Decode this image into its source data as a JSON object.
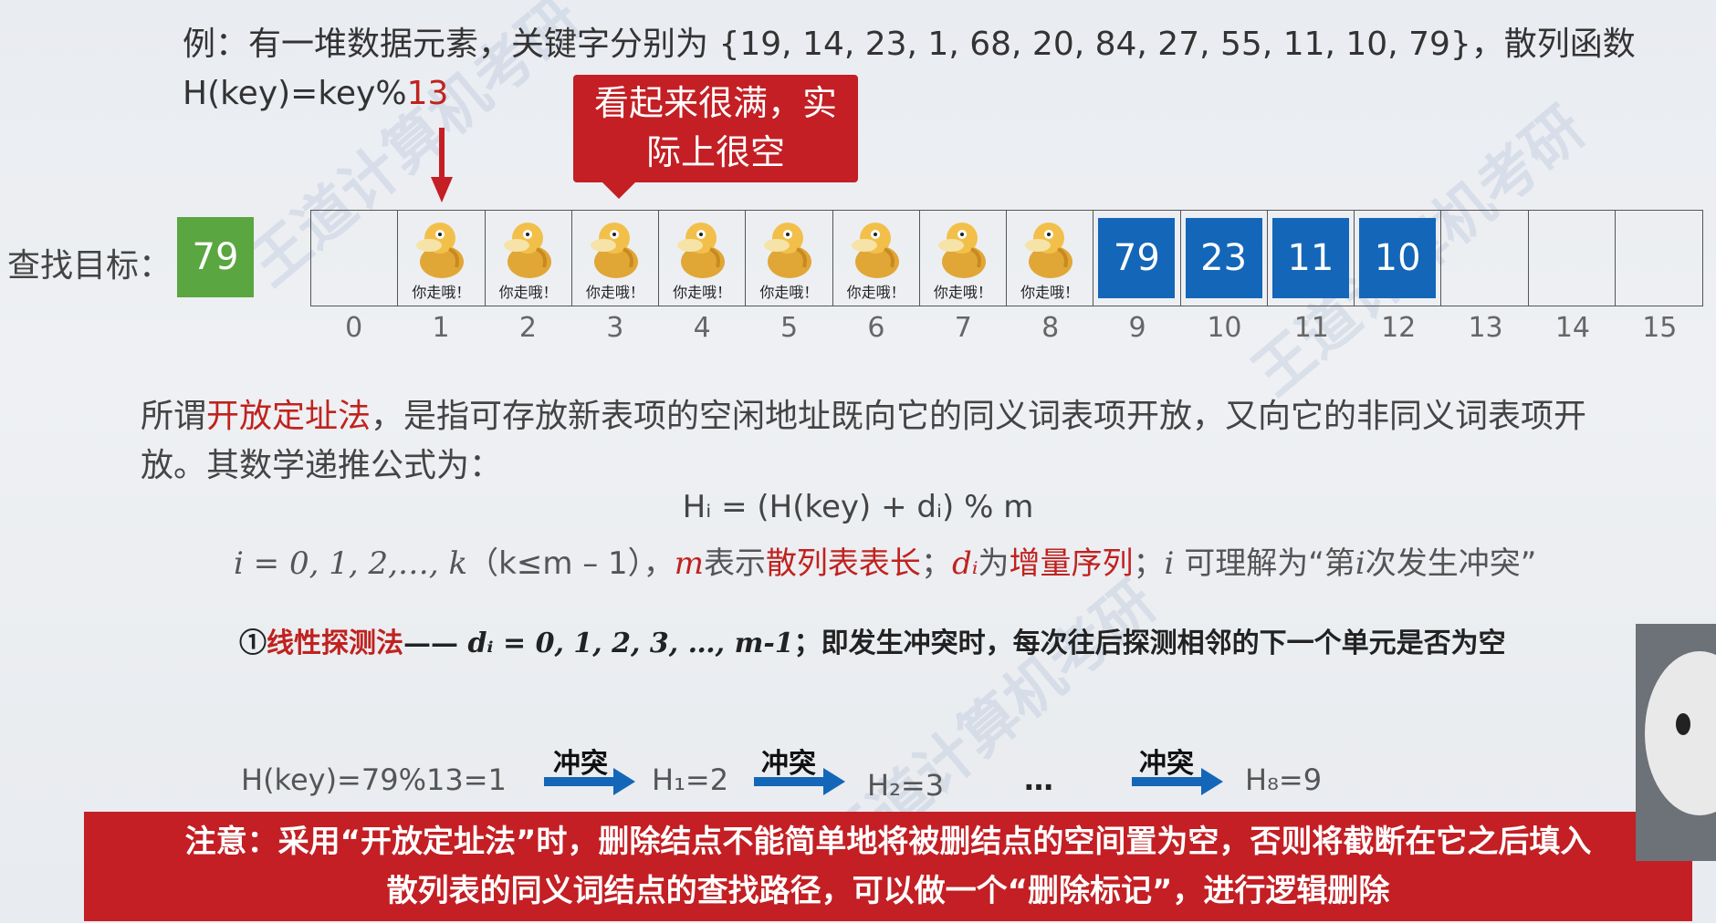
{
  "intro": {
    "line1": "例：有一堆数据元素，关键字分别为 {19, 14, 23, 1, 68, 20, 84, 27, 55, 11, 10, 79}，散列函数",
    "line2_prefix": "H(key)=key%",
    "line2_mod": "13"
  },
  "callout": {
    "line1": "看起来很满，实",
    "line2": "际上很空"
  },
  "target": {
    "label": "查找目标：",
    "value": "79"
  },
  "table": {
    "cells": [
      {
        "type": "empty",
        "text": ""
      },
      {
        "type": "duck",
        "text": "你走哦！"
      },
      {
        "type": "duck",
        "text": "你走哦！"
      },
      {
        "type": "duck",
        "text": "你走哦！"
      },
      {
        "type": "duck",
        "text": "你走哦！"
      },
      {
        "type": "duck",
        "text": "你走哦！"
      },
      {
        "type": "duck",
        "text": "你走哦！"
      },
      {
        "type": "duck",
        "text": "你走哦！"
      },
      {
        "type": "duck",
        "text": "你走哦！"
      },
      {
        "type": "value",
        "text": "79"
      },
      {
        "type": "value",
        "text": "23"
      },
      {
        "type": "value",
        "text": "11"
      },
      {
        "type": "value",
        "text": "10"
      },
      {
        "type": "empty",
        "text": ""
      },
      {
        "type": "empty",
        "text": ""
      },
      {
        "type": "empty",
        "text": ""
      }
    ],
    "indices": [
      "0",
      "1",
      "2",
      "3",
      "4",
      "5",
      "6",
      "7",
      "8",
      "9",
      "10",
      "11",
      "12",
      "13",
      "14",
      "15"
    ]
  },
  "paragraph": {
    "p1": "所谓",
    "term": "开放定址法",
    "p2": "，是指可存放新表项的空闲地址既向它的同义词表项开放，又向它的非同义词表项开",
    "p3": "放。其数学递推公式为："
  },
  "formula": {
    "main": "Hᵢ = (H(key) + dᵢ) % m",
    "i_range": "i = 0, 1, 2,…, k",
    "k_cond": "（k≤m – 1）",
    "sep": "，",
    "m": "m",
    "m_desc": "表示",
    "m_term": "散列表表长",
    "semi1": "；",
    "d": "dᵢ",
    "d_desc": "为",
    "d_term": "增量序列",
    "semi2": "；",
    "i": "i",
    "i_desc": " 可理解为“第",
    "i2": "i",
    "i_desc2": "次发生冲突”"
  },
  "linear": {
    "circle": "①",
    "term": "线性探测法",
    "dash": "——",
    "formula": "dᵢ = 0, 1, 2, 3, …, m-1",
    "desc": "；即发生冲突时，每次往后探测相邻的下一个单元是否为空"
  },
  "probe": {
    "start": "H(key)=79%13=1",
    "label": "冲突",
    "h1": "H₁=2",
    "h2": "H₂=3",
    "dots": "…",
    "h8": "H₈=9"
  },
  "note": {
    "line1": "注意：采用“开放定址法”时，删除结点不能简单地将被删结点的空间置为空，否则将截断在它之后填入",
    "line2": "散列表的同义词结点的查找路径，可以做一个“删除标记”，进行逻辑删除"
  },
  "colors": {
    "red": "#c31f24",
    "blue": "#1466b8",
    "green": "#5aa640"
  }
}
